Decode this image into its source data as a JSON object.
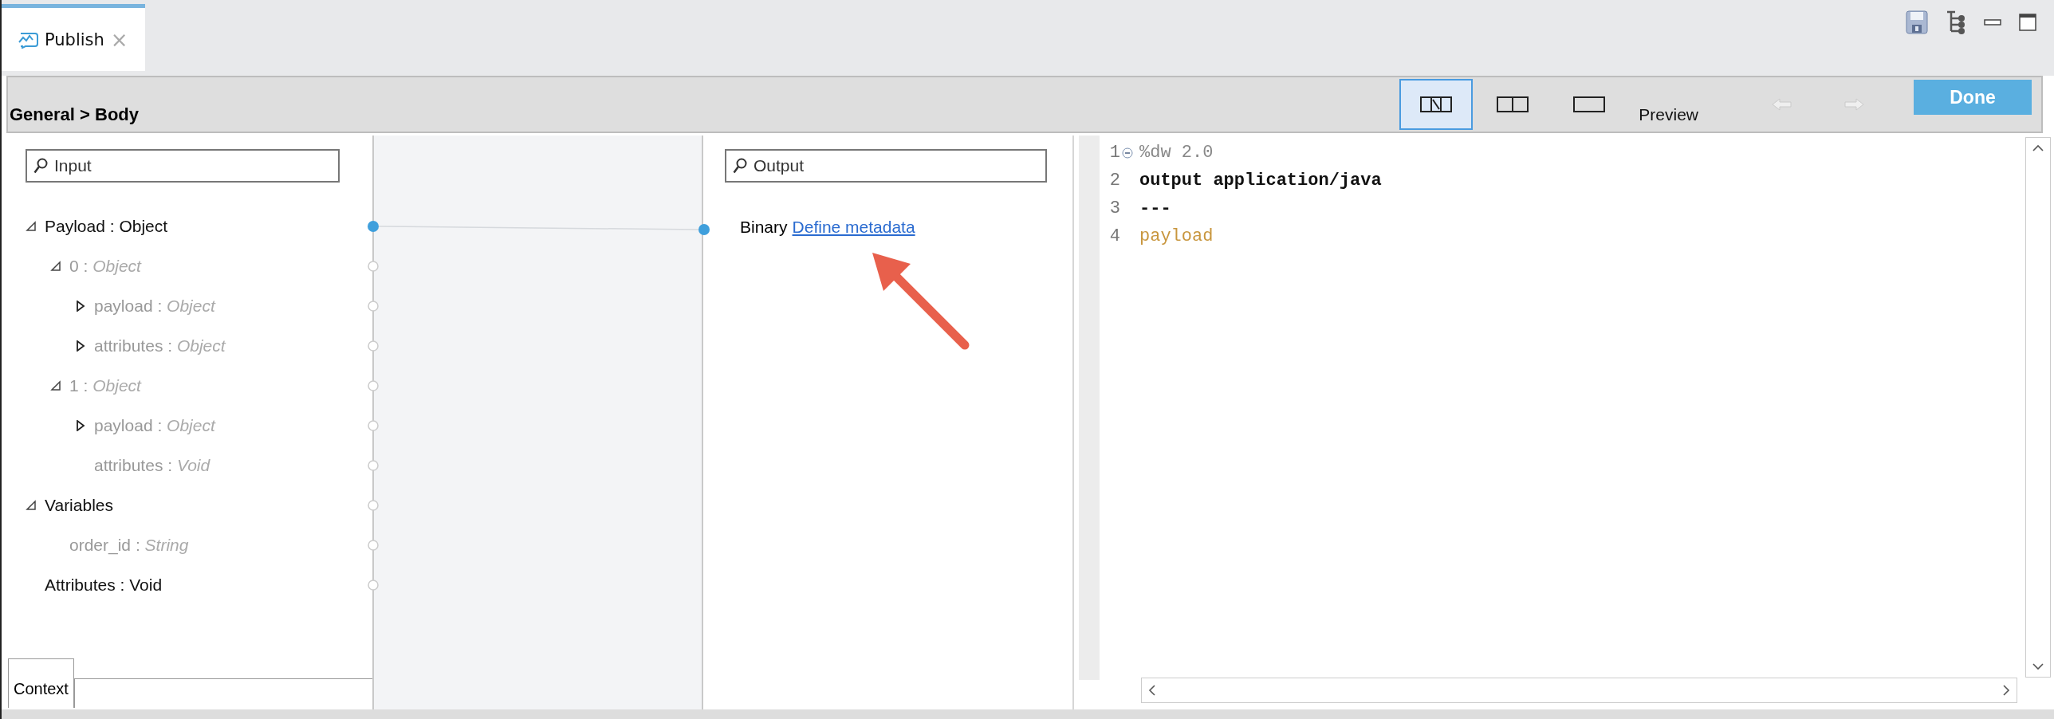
{
  "tabs": [
    {
      "label": "Publish",
      "close": "×",
      "selected": true
    }
  ],
  "header": {
    "breadcrumb": "General > Body",
    "layouts": [
      {
        "kind": "split-mapping",
        "selected": true
      },
      {
        "kind": "split",
        "selected": false
      },
      {
        "kind": "single",
        "selected": false
      }
    ],
    "preview": "Preview",
    "history": [
      {
        "kind": "undo",
        "disabled": true
      },
      {
        "kind": "redo",
        "disabled": true
      }
    ],
    "done": "Done"
  },
  "input": {
    "placeholder": "Input",
    "tree": [
      {
        "name": "Payload",
        "sep": ":",
        "type": "Object",
        "expanded": true,
        "mapped": true,
        "children": [
          {
            "name": "0",
            "sep": ":",
            "type": "Object",
            "expanded": true,
            "mapped": false,
            "children": [
              {
                "name": "payload",
                "sep": ":",
                "type": "Object",
                "expanded": false,
                "mapped": false
              },
              {
                "name": "attributes",
                "sep": ":",
                "type": "Object",
                "expanded": false,
                "mapped": false
              }
            ]
          },
          {
            "name": "1",
            "sep": ":",
            "type": "Object",
            "expanded": true,
            "mapped": false,
            "children": [
              {
                "name": "payload",
                "sep": ":",
                "type": "Object",
                "expanded": false,
                "mapped": false
              },
              {
                "name": "attributes",
                "sep": ":",
                "type": "Void",
                "mapped": false
              }
            ]
          }
        ]
      },
      {
        "name": "Variables",
        "expanded": true,
        "mapped": false,
        "children": [
          {
            "name": "order_id",
            "sep": ":",
            "type": "String",
            "mapped": false
          }
        ]
      },
      {
        "name": "Attributes",
        "sep": ":",
        "type": "Void",
        "mapped": false
      }
    ],
    "context_tab": "Context"
  },
  "output": {
    "placeholder": "Output",
    "type_label": "Binary",
    "link": "Define metadata",
    "mapped": true
  },
  "code": [
    {
      "number": "1",
      "text": "%dw 2.0",
      "kind": "directive",
      "foldable": true
    },
    {
      "number": "2",
      "text": "output application/java",
      "kind": "keyword",
      "foldable": false
    },
    {
      "number": "3",
      "text": "---",
      "kind": "keyword",
      "foldable": false
    },
    {
      "number": "4",
      "text": "payload",
      "kind": "value",
      "foldable": false
    }
  ]
}
